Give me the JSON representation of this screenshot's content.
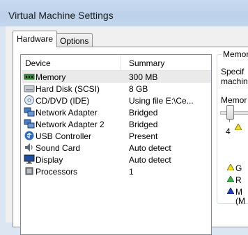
{
  "window": {
    "title": "Virtual Machine Settings"
  },
  "tabs": [
    {
      "label": "Hardware"
    },
    {
      "label": "Options"
    }
  ],
  "list": {
    "headers": {
      "device": "Device",
      "summary": "Summary"
    },
    "rows": [
      {
        "device": "Memory",
        "summary": "300 MB",
        "icon": "memory-icon"
      },
      {
        "device": "Hard Disk (SCSI)",
        "summary": "8 GB",
        "icon": "hard-disk-icon"
      },
      {
        "device": "CD/DVD (IDE)",
        "summary": "Using file E:\\Ce...",
        "icon": "cd-dvd-icon"
      },
      {
        "device": "Network Adapter",
        "summary": "Bridged",
        "icon": "network-adapter-icon"
      },
      {
        "device": "Network Adapter 2",
        "summary": "Bridged",
        "icon": "network-adapter-icon"
      },
      {
        "device": "USB Controller",
        "summary": "Present",
        "icon": "usb-icon"
      },
      {
        "device": "Sound Card",
        "summary": "Auto detect",
        "icon": "sound-card-icon"
      },
      {
        "device": "Display",
        "summary": "Auto detect",
        "icon": "display-icon"
      },
      {
        "device": "Processors",
        "summary": "1",
        "icon": "processor-icon"
      }
    ]
  },
  "memory_panel": {
    "group_label": "Memor",
    "desc_line1": "Specif",
    "desc_line2": "machin",
    "slider_label": "Memor",
    "scale_value": "4",
    "legend_1": "G",
    "legend_2": "R",
    "legend_3": "M",
    "legend_3b": "(M",
    "colors": {
      "yellow": "#f0e020",
      "green": "#39b54a",
      "blue": "#1f3fbf"
    }
  }
}
